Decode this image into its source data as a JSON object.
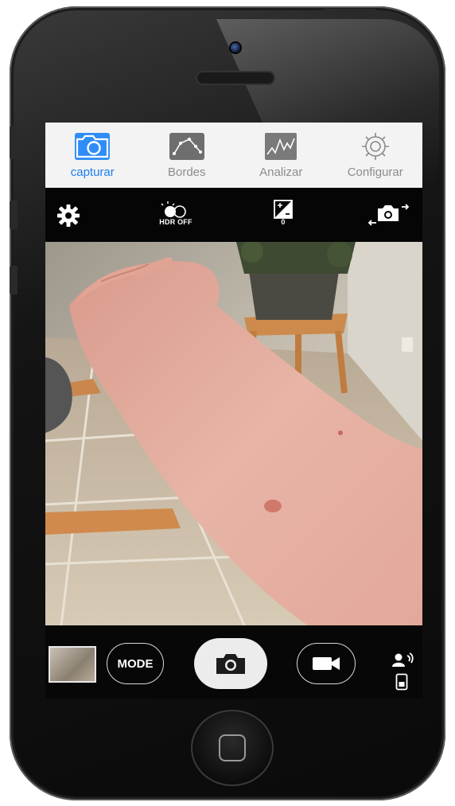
{
  "tabs": [
    {
      "label": "capturar",
      "icon": "camera-icon",
      "active": true
    },
    {
      "label": "Bordes",
      "icon": "edges-icon",
      "active": false
    },
    {
      "label": "Analizar",
      "icon": "analyze-icon",
      "active": false
    },
    {
      "label": "Configurar",
      "icon": "gear-icon",
      "active": false
    }
  ],
  "controls": {
    "hdr_label": "HDR OFF",
    "exposure_value": "0"
  },
  "bottom": {
    "mode_label": "MODE"
  },
  "colors": {
    "accent": "#1b7ef0",
    "tab_inactive": "#8c8c8c"
  }
}
